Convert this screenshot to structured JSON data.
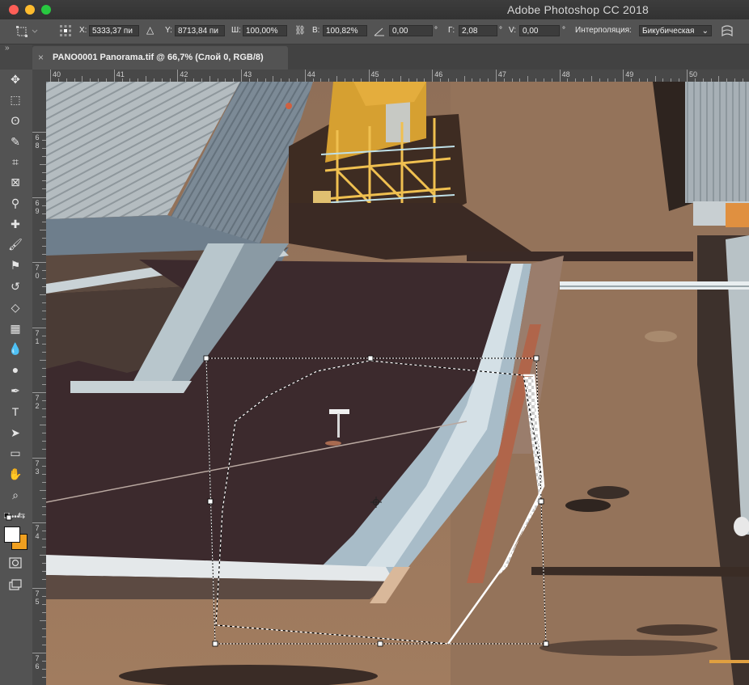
{
  "window": {
    "app_title": "Adobe Photoshop CC 2018"
  },
  "options_bar": {
    "x_label": "X:",
    "x_value": "5333,37 пи",
    "y_label": "Y:",
    "y_value": "8713,84 пи",
    "w_label": "Ш:",
    "w_value": "100,00%",
    "h_label": "В:",
    "h_value": "100,82%",
    "angle_value": "0,00",
    "angle_unit": "°",
    "hskew_label": "Г:",
    "hskew_value": "2,08",
    "hskew_unit": "°",
    "vskew_label": "V:",
    "vskew_value": "0,00",
    "vskew_unit": "°",
    "interp_label": "Интерполяция:",
    "interp_value": "Бикубическая"
  },
  "document_tab": {
    "label": "PANO0001 Panorama.tif @ 66,7% (Слой 0, RGB/8)",
    "close_glyph": "×"
  },
  "toolbar": {
    "collapse_glyph": "»",
    "tools": [
      {
        "name": "move-tool",
        "glyph": "✥"
      },
      {
        "name": "marquee-tool",
        "glyph": "⬚"
      },
      {
        "name": "lasso-tool",
        "glyph": "ʘ"
      },
      {
        "name": "quick-select-tool",
        "glyph": "✎"
      },
      {
        "name": "crop-tool",
        "glyph": "⌗"
      },
      {
        "name": "frame-tool",
        "glyph": "⊠"
      },
      {
        "name": "eyedropper-tool",
        "glyph": "⚲"
      },
      {
        "name": "healing-brush-tool",
        "glyph": "✚"
      },
      {
        "name": "brush-tool",
        "glyph": "🖌"
      },
      {
        "name": "stamp-tool",
        "glyph": "⚑"
      },
      {
        "name": "history-brush-tool",
        "glyph": "↺"
      },
      {
        "name": "eraser-tool",
        "glyph": "◇"
      },
      {
        "name": "gradient-tool",
        "glyph": "▦"
      },
      {
        "name": "blur-tool",
        "glyph": "💧"
      },
      {
        "name": "dodge-tool",
        "glyph": "●"
      },
      {
        "name": "pen-tool",
        "glyph": "✒"
      },
      {
        "name": "type-tool",
        "glyph": "T"
      },
      {
        "name": "path-select-tool",
        "glyph": "➤"
      },
      {
        "name": "rectangle-tool",
        "glyph": "▭"
      },
      {
        "name": "hand-tool",
        "glyph": "✋"
      },
      {
        "name": "zoom-tool",
        "glyph": "⌕"
      },
      {
        "name": "more-tools",
        "glyph": "•••"
      }
    ],
    "foreground_color": "#ffffff",
    "background_color": "#f0a020"
  },
  "rulers": {
    "top_labels": [
      "40",
      "41",
      "42",
      "43",
      "44",
      "45",
      "46",
      "47",
      "48",
      "49",
      "50"
    ],
    "left_labels": [
      [
        "6",
        "8"
      ],
      [
        "6",
        "9"
      ],
      [
        "7",
        "0"
      ],
      [
        "7",
        "1"
      ],
      [
        "7",
        "2"
      ],
      [
        "7",
        "3"
      ],
      [
        "7",
        "4"
      ],
      [
        "7",
        "5"
      ],
      [
        "7",
        "6"
      ]
    ]
  },
  "colors": {
    "chrome_dark": "#2b2b2b",
    "panel": "#535353",
    "field": "#3c3c3c",
    "roof_dark": "#3a2a2d",
    "roof_tan": "#9a7a60",
    "metal_roof": "#9ea8ae",
    "crane_yellow": "#d9a030"
  }
}
